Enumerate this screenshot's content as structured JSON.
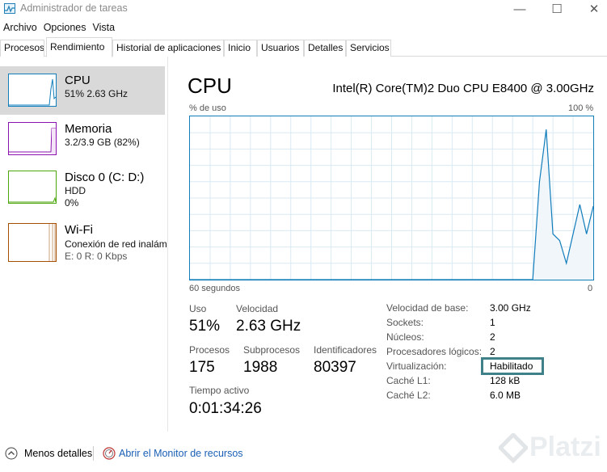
{
  "window": {
    "title": "Administrador de tareas",
    "controls": {
      "minimize": "—",
      "maximize": "☐",
      "close": "✕"
    }
  },
  "menu": [
    "Archivo",
    "Opciones",
    "Vista"
  ],
  "tabs": [
    "Procesos",
    "Rendimiento",
    "Historial de aplicaciones",
    "Inicio",
    "Usuarios",
    "Detalles",
    "Servicios"
  ],
  "active_tab": "Rendimiento",
  "sidebar": {
    "items": [
      {
        "name": "CPU",
        "line1": "51%  2.63 GHz",
        "line2": "",
        "color": "#117dbb",
        "selected": true
      },
      {
        "name": "Memoria",
        "line1": "3.2/3.9 GB (82%)",
        "line2": "",
        "color": "#8b12ae",
        "selected": false
      },
      {
        "name": "Disco 0 (C: D:)",
        "line1": "HDD",
        "line2": "0%",
        "color": "#4da60c",
        "selected": false
      },
      {
        "name": "Wi-Fi",
        "line1": "Conexión de red inalám",
        "line2": "E: 0  R: 0 Kbps",
        "color": "#a74f01",
        "selected": false
      }
    ]
  },
  "cpu_panel": {
    "title": "CPU",
    "model": "Intel(R) Core(TM)2 Duo CPU E8400 @ 3.00GHz",
    "graph": {
      "y_label": "% de uso",
      "y_max_label": "100 %",
      "x_label": "60 segundos",
      "x_min_label": "0",
      "usage_history_percent": [
        0,
        0,
        0,
        0,
        0,
        0,
        0,
        0,
        0,
        0,
        0,
        0,
        0,
        0,
        0,
        0,
        0,
        0,
        0,
        0,
        0,
        0,
        0,
        0,
        0,
        0,
        0,
        0,
        0,
        0,
        0,
        0,
        0,
        0,
        0,
        0,
        0,
        0,
        0,
        0,
        0,
        0,
        0,
        0,
        0,
        0,
        0,
        0,
        0,
        0,
        0,
        0,
        60,
        92,
        28,
        24,
        10,
        28,
        46,
        28,
        45
      ]
    },
    "stats": {
      "uso_label": "Uso",
      "uso_value": "51%",
      "velocidad_label": "Velocidad",
      "velocidad_value": "2.63 GHz",
      "procesos_label": "Procesos",
      "procesos_value": "175",
      "subprocesos_label": "Subprocesos",
      "subprocesos_value": "1988",
      "identificadores_label": "Identificadores",
      "identificadores_value": "80397",
      "tiempo_label": "Tiempo activo",
      "tiempo_value": "0:01:34:26"
    },
    "properties": [
      {
        "label": "Velocidad de base:",
        "value": "3.00 GHz"
      },
      {
        "label": "Sockets:",
        "value": "1"
      },
      {
        "label": "Núcleos:",
        "value": "2"
      },
      {
        "label": "Procesadores lógicos:",
        "value": "2"
      },
      {
        "label": "Virtualización:",
        "value": "Habilitado"
      },
      {
        "label": "Caché L1:",
        "value": "128 kB"
      },
      {
        "label": "Caché L2:",
        "value": "6.0 MB"
      }
    ]
  },
  "footer": {
    "less_details": "Menos detalles",
    "resource_monitor": "Abrir el Monitor de recursos"
  },
  "watermark": "Platzi",
  "colors": {
    "cpu": "#117dbb",
    "memory": "#8b12ae",
    "disk": "#4da60c",
    "wifi": "#a74f01",
    "highlight": "#3f8089"
  }
}
